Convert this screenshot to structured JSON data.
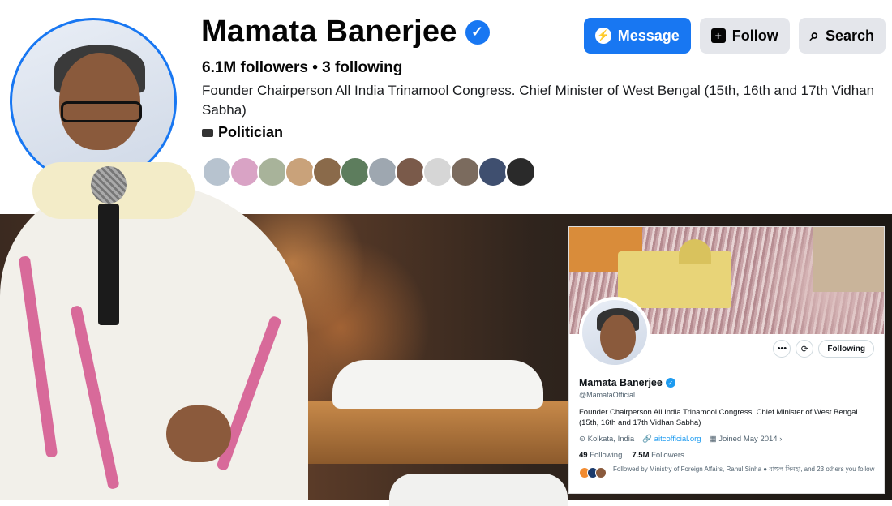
{
  "facebook": {
    "name": "Mamata Banerjee",
    "stats": "6.1M followers • 3 following",
    "bio": "Founder Chairperson All India Trinamool Congress. Chief Minister of West Bengal (15th, 16th and 17th Vidhan Sabha)",
    "category": "Politician",
    "buttons": {
      "message": "Message",
      "follow": "Follow",
      "search": "Search"
    },
    "friend_colors": [
      "#b7c3cf",
      "#d9a3c5",
      "#a8b39a",
      "#c9a27a",
      "#8a6a4a",
      "#5d7d5d",
      "#9ea7b0",
      "#7a5a4a",
      "#d6d6d6",
      "#7b6b5e",
      "#3f4f6f",
      "#2a2a2a"
    ],
    "accent": "#1877f2"
  },
  "x_profile": {
    "name": "Mamata Banerjee",
    "handle": "@MamataOfficial",
    "bio": "Founder Chairperson All India Trinamool Congress. Chief Minister of West Bengal (15th, 16th and 17th Vidhan Sabha)",
    "location": "Kolkata, India",
    "link": "aitcofficial.org",
    "joined": "Joined May 2014",
    "following_count": "49",
    "following_label": "Following",
    "followers_count": "7.5M",
    "followers_label": "Followers",
    "follow_button": "Following",
    "followed_by": "Followed by Ministry of Foreign Affairs, Rahul Sinha ● রাহুল সিনহা, and 23 others you follow",
    "accent": "#1d9bf0"
  }
}
